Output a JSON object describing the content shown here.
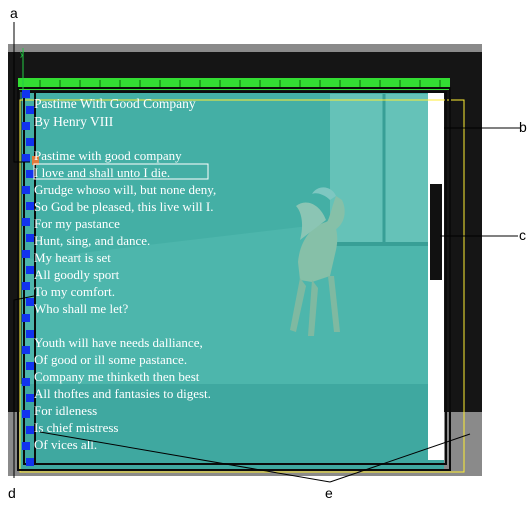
{
  "callouts": {
    "a": "a",
    "b": "b",
    "c": "c",
    "d": "d",
    "e": "e"
  },
  "poem": {
    "title": "Pastime With Good Company",
    "byline": "By Henry VIII",
    "lines": [
      "Pastime with good company",
      "I love and shall unto I die.",
      "Grudge whoso will, but none deny,",
      "So God be pleased, this live will I.",
      "For my pastance",
      "Hunt, sing, and dance.",
      "My heart is set",
      "All goodly sport",
      "To my comfort.",
      "Who shall me let?",
      "",
      "Youth will have needs dalliance,",
      "Of good or ill some pastance.",
      "Company me thinketh then best",
      "All thoftes and fantasies to digest.",
      "For idleness",
      "Is chief mistress",
      "Of vices all."
    ]
  },
  "colors": {
    "outer_frame": "#8a8a8a",
    "dark_area": "#151515",
    "ruler": "#33dd33",
    "overlay": "#3fa8a0",
    "photo_tint": "#5fc7b8",
    "scrollbar_track": "#ffffff",
    "scrollbar_thumb": "#111111",
    "guide_yellow": "#ffee33",
    "marker_blue": "#1133ee",
    "guide_green": "#22cc44"
  }
}
